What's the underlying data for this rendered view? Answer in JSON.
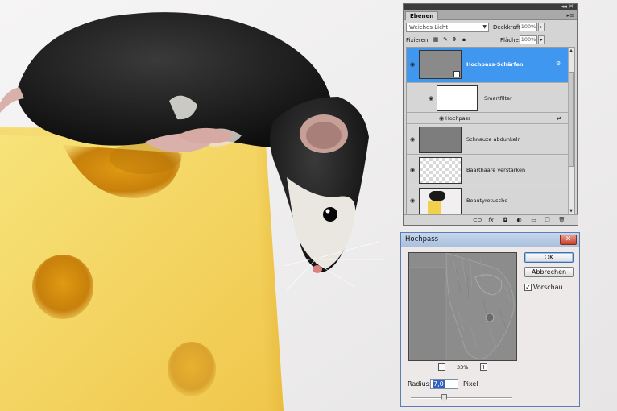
{
  "layers_panel": {
    "tab_label": "Ebenen",
    "panel_controls": "◂◂ ✕",
    "menu_button": "▸≡",
    "blend_mode": "Weiches Licht",
    "opacity_label": "Deckkraft:",
    "opacity_value": "100%",
    "lock_label": "Fixieren:",
    "fill_label": "Fläche:",
    "fill_value": "100%",
    "layers": [
      {
        "name": "Hochpass-Schärfen",
        "selected": true
      },
      {
        "name": "Smartfilter"
      },
      {
        "name": "Hochpass"
      },
      {
        "name": "Schnauze abdunkeln"
      },
      {
        "name": "Baarthaare verstärken"
      },
      {
        "name": "Beautyretusche"
      }
    ],
    "footer_icons": [
      "link-icon",
      "fx-icon",
      "mask-icon",
      "adjustment-icon",
      "group-icon",
      "new-layer-icon",
      "trash-icon"
    ]
  },
  "dialog": {
    "title": "Hochpass",
    "close_label": "✕",
    "ok_label": "OK",
    "cancel_label": "Abbrechen",
    "preview_label": "Vorschau",
    "preview_checked": true,
    "zoom_out_label": "−",
    "zoom_in_label": "+",
    "zoom_value": "33%",
    "radius_label": "Radius:",
    "radius_value": "7,0",
    "radius_unit": "Pixel",
    "radius_slider_fraction": 0.33
  }
}
